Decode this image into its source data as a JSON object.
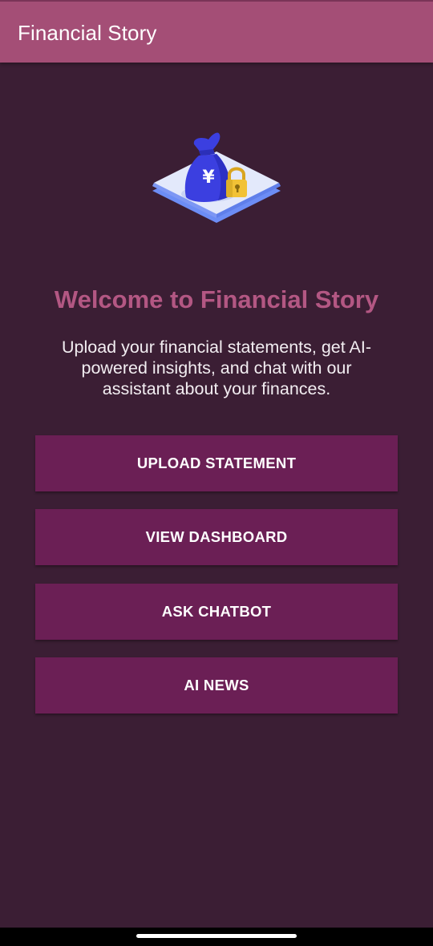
{
  "app_bar": {
    "title": "Financial Story"
  },
  "hero": {
    "illustration_icon": "money-bag-lock-icon",
    "currency_symbol": "¥",
    "title": "Welcome to Financial Story",
    "subtitle": "Upload your financial statements, get AI-powered insights, and chat with our assistant about your finances."
  },
  "actions": {
    "upload_label": "UPLOAD STATEMENT",
    "dashboard_label": "VIEW DASHBOARD",
    "chatbot_label": "ASK CHATBOT",
    "news_label": "AI NEWS"
  },
  "colors": {
    "app_bar": "#a44e76",
    "background": "#3b1e34",
    "title_accent": "#b35783",
    "button": "#6b1f55",
    "illustration_bag": "#3b3fe0",
    "illustration_lock": "#f2c236",
    "illustration_platform": "#dfe6fb"
  }
}
